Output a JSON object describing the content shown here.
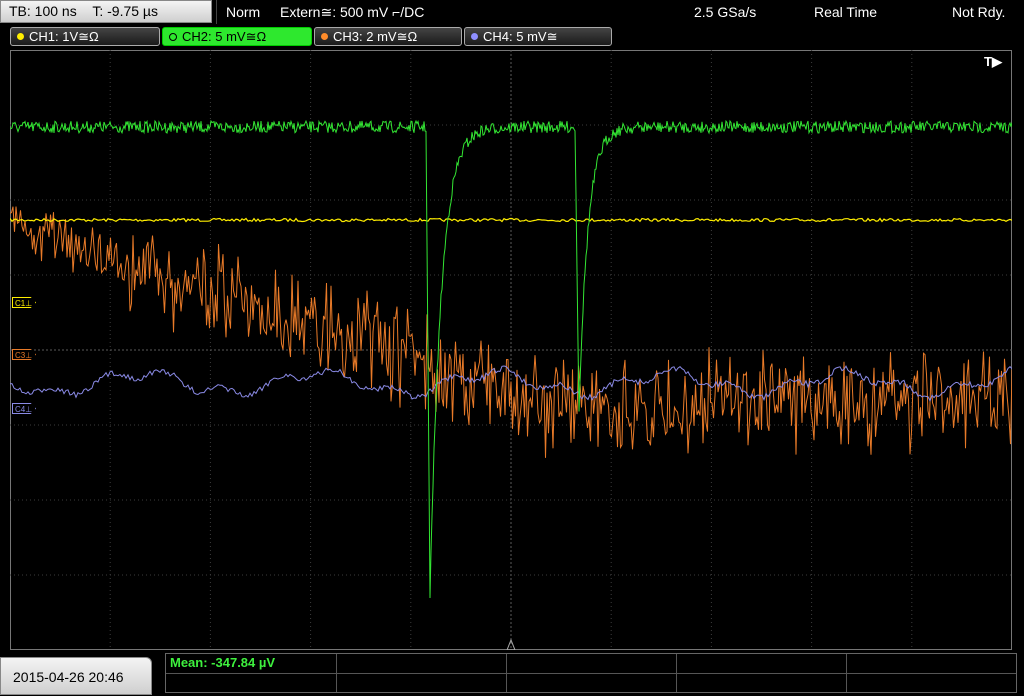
{
  "topbar": {
    "timebase": "TB: 100 ns",
    "trigger_time": "T: -9.75 µs",
    "mode": "Norm",
    "trigger_source": "Extern≅: 500 mV ⌐/DC",
    "sample_rate": "2.5 GSa/s",
    "acq_mode": "Real Time",
    "state": "Not Rdy."
  },
  "channels": [
    {
      "label": "CH1: 1V≅Ω",
      "color": "#ffee00"
    },
    {
      "label": "CH2: 5 mV≅Ω",
      "color": "#2ee82e"
    },
    {
      "label": "CH3: 2 mV≅Ω",
      "color": "#ff8c2a"
    },
    {
      "label": "CH4: 5 mV≅",
      "color": "#8f8fff"
    }
  ],
  "markers": {
    "c1": "C1⊥",
    "c3": "C3⊥",
    "c4": "C4⊥",
    "trigger": "T▶"
  },
  "bottom": {
    "datetime": "2015-04-26 20:46",
    "mean": "Mean: -347.84 µV"
  },
  "colors": {
    "ch1": "#ffee00",
    "ch2": "#33e633",
    "ch3": "#e87a28",
    "ch4": "#8a8ae6",
    "grid": "#3c3c3c"
  }
}
